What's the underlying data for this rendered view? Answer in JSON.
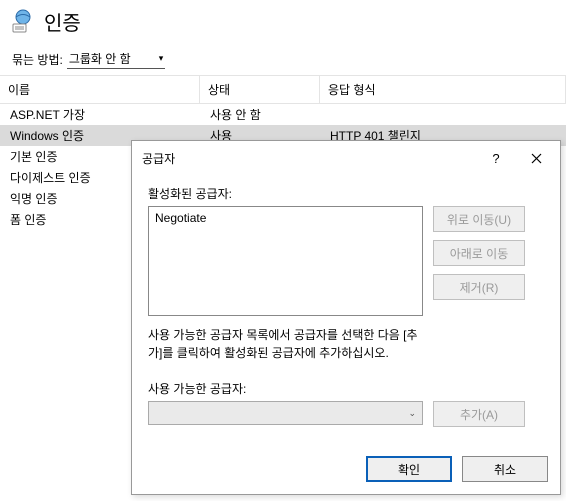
{
  "page": {
    "title": "인증"
  },
  "groupbar": {
    "label": "묶는 방법:",
    "value": "그룹화 안 함"
  },
  "columns": {
    "name": "이름",
    "status": "상태",
    "response": "응답 형식"
  },
  "rows": [
    {
      "name": "ASP.NET 가장",
      "status": "사용 안 함",
      "response": ""
    },
    {
      "name": "Windows 인증",
      "status": "사용",
      "response": "HTTP 401 챌린지"
    },
    {
      "name": "기본 인증",
      "status": "",
      "response": ""
    },
    {
      "name": "다이제스트 인증",
      "status": "",
      "response": ""
    },
    {
      "name": "익명 인증",
      "status": "",
      "response": ""
    },
    {
      "name": "폼 인증",
      "status": "",
      "response": ""
    }
  ],
  "dialog": {
    "title": "공급자",
    "enabled_label": "활성화된 공급자:",
    "list_item0": "Negotiate",
    "btn_up": "위로 이동(U)",
    "btn_down": "아래로 이동",
    "btn_remove": "제거(R)",
    "hint": "사용 가능한 공급자 목록에서 공급자를 선택한 다음 [추가]를 클릭하여 활성화된 공급자에 추가하십시오.",
    "avail_label": "사용 가능한 공급자:",
    "btn_add": "추가(A)",
    "ok": "확인",
    "cancel": "취소"
  }
}
